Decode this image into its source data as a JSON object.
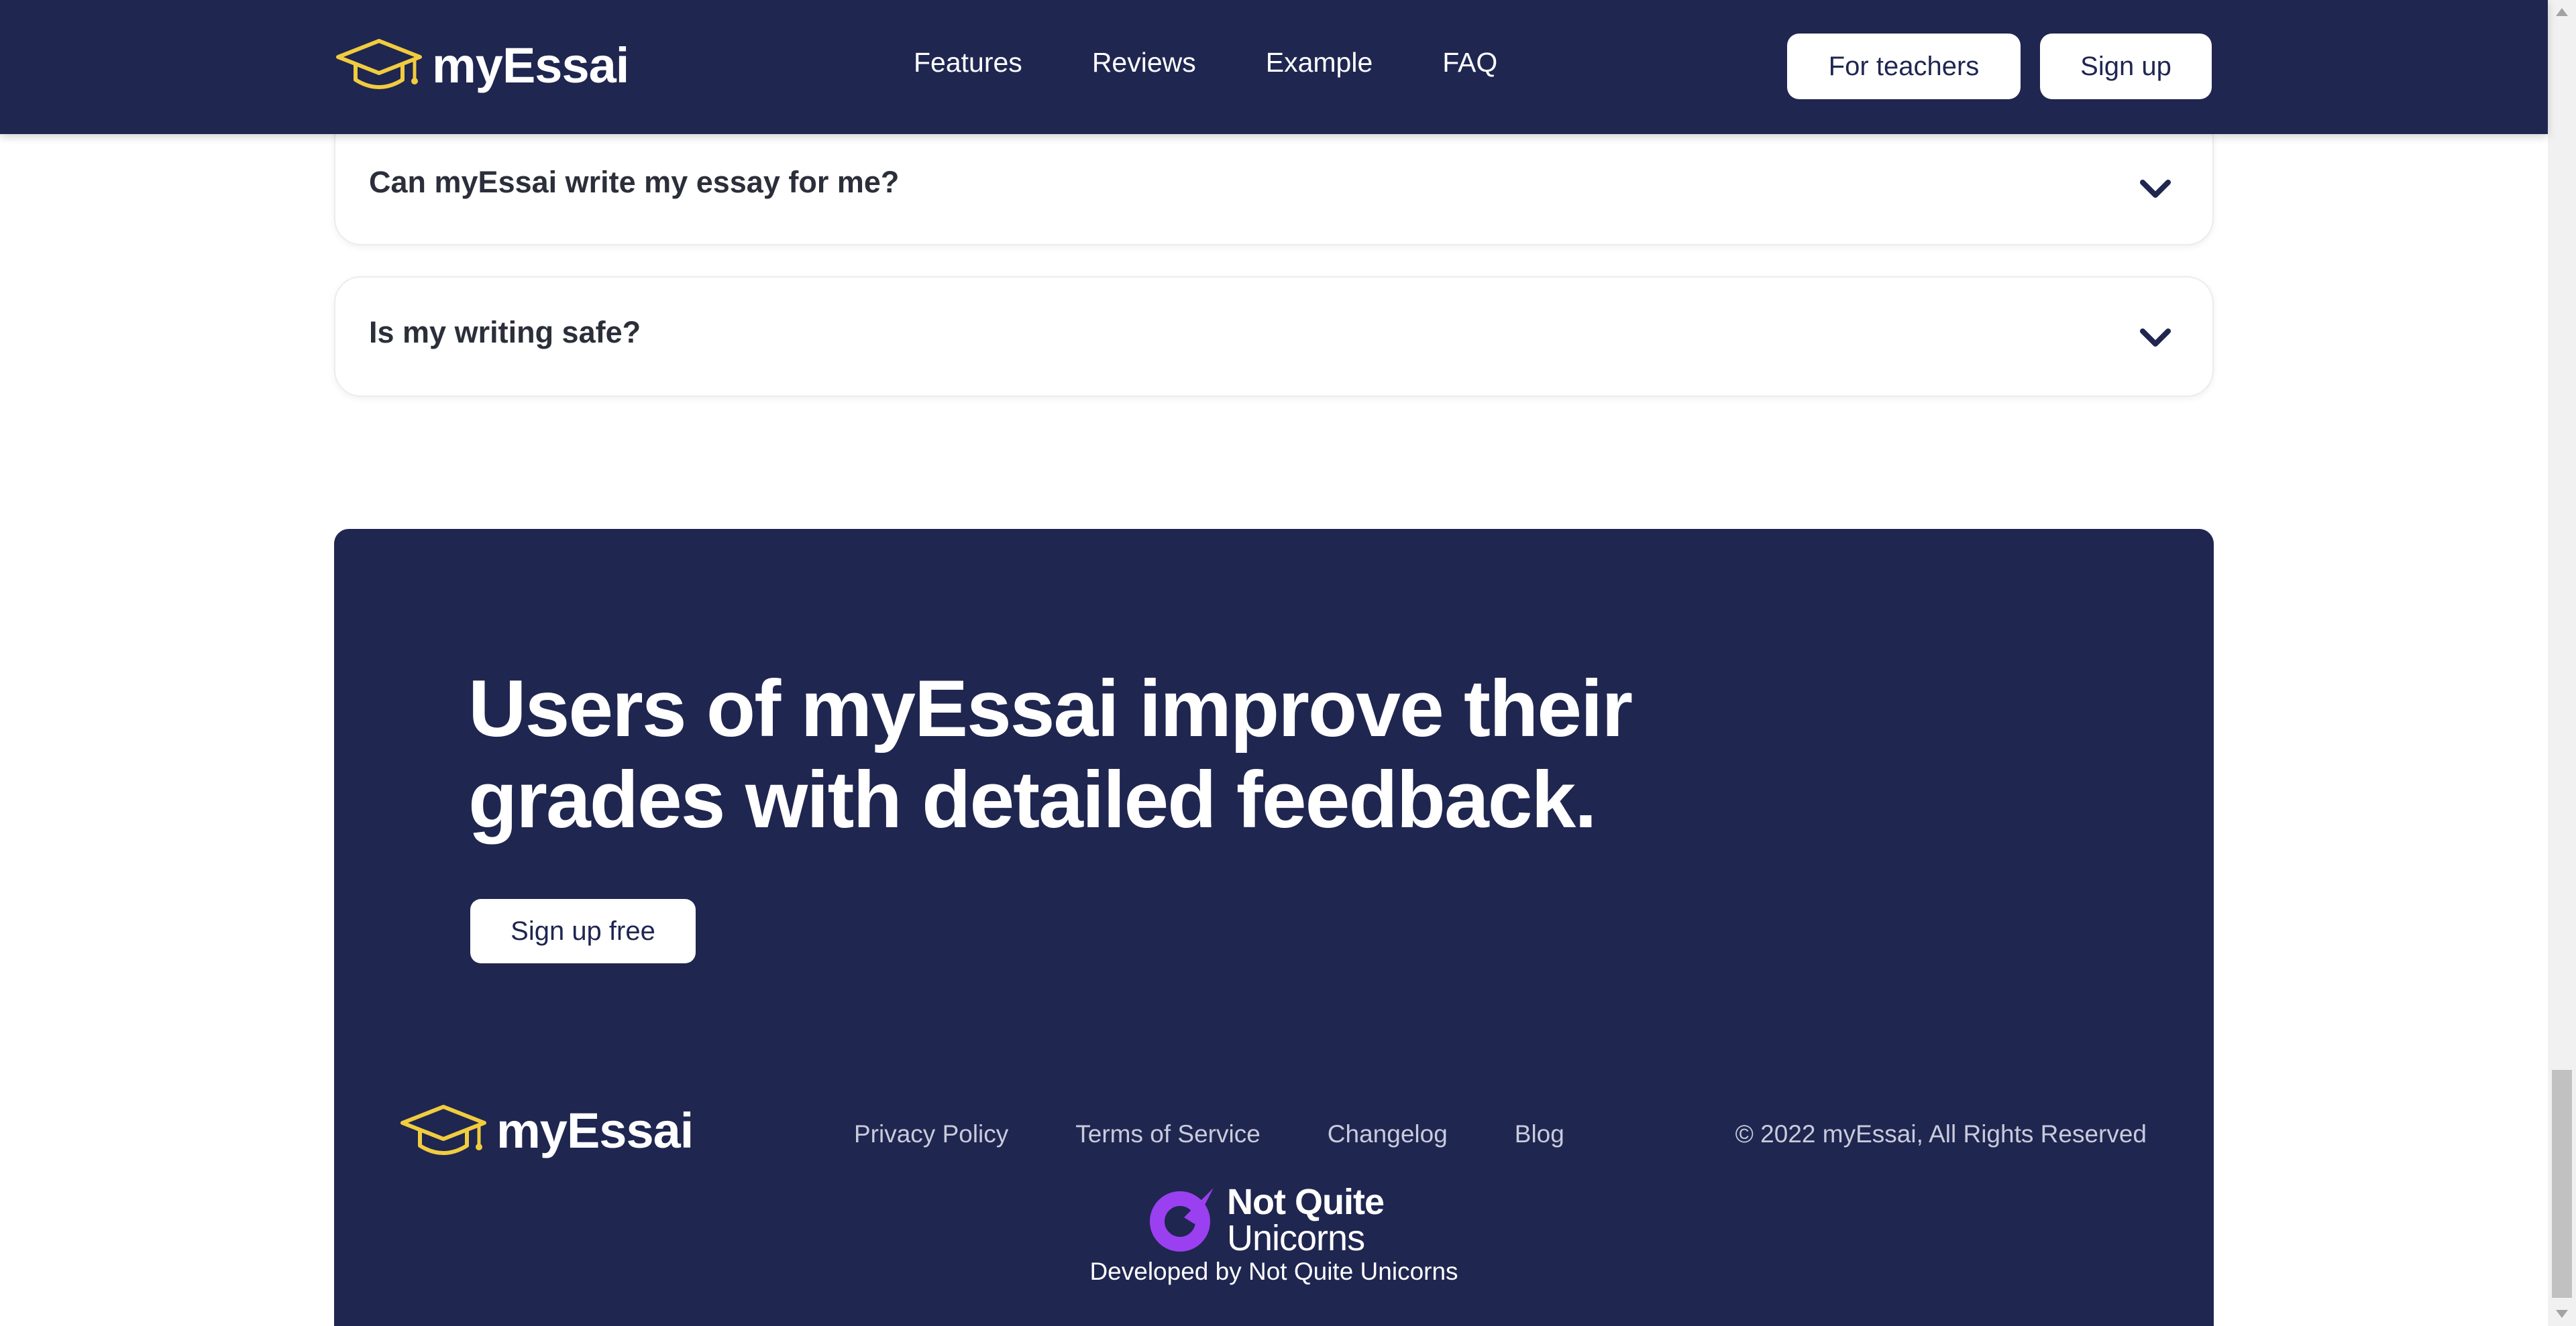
{
  "header": {
    "brand": "myEssai",
    "nav": [
      "Features",
      "Reviews",
      "Example",
      "FAQ"
    ],
    "for_teachers": "For teachers",
    "sign_up": "Sign up"
  },
  "faq": [
    {
      "question": "Can myEssai write my essay for me?"
    },
    {
      "question": "Is my writing safe?"
    }
  ],
  "cta": {
    "headline_line1": "Users of myEssai improve their",
    "headline_line2": "grades with detailed feedback.",
    "button": "Sign up free"
  },
  "footer": {
    "brand": "myEssai",
    "links": [
      "Privacy Policy",
      "Terms of Service",
      "Changelog",
      "Blog"
    ],
    "copyright": "© 2022 myEssai, All Rights Reserved",
    "partner_line1": "Not Quite",
    "partner_line2": "Unicorns",
    "developed_by": "Developed by Not Quite Unicorns"
  },
  "colors": {
    "navy": "#1f2650",
    "logo_gold": "#f1cc3e",
    "partner_purple": "#9b40f0"
  },
  "icons": [
    "graduation-cap-icon",
    "chevron-down-icon",
    "not-quite-unicorns-logo-icon"
  ]
}
